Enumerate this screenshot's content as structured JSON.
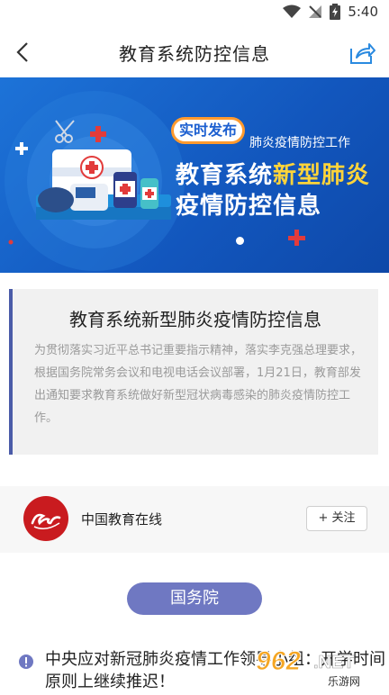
{
  "status_bar": {
    "time": "5:40"
  },
  "header": {
    "title": "教育系统防控信息"
  },
  "banner": {
    "tag": "实时发布",
    "subtitle": "肺炎疫情防控工作",
    "headline_part1": "教育系统",
    "headline_accent": "新型肺炎",
    "headline_line2": "疫情防控信息"
  },
  "intro": {
    "title": "教育系统新型肺炎疫情防控信息",
    "body": "为贯彻落实习近平总书记重要指示精神，落实李克强总理要求，根据国务院常务会议和电视电话会议部署，1月21日，教育部发出通知要求教育系统做好新型冠状病毒感染的肺炎疫情防控工作。"
  },
  "source": {
    "name": "中国教育在线",
    "follow_label": "+ 关注"
  },
  "section": {
    "label": "国务院"
  },
  "news": [
    {
      "text": "中央应对新冠肺炎疫情工作领导小组：开学时间原则上继续推迟！"
    }
  ],
  "watermark": {
    "main": "962",
    "suffix": ".NET",
    "sub": "乐游网"
  },
  "colors": {
    "banner_blue": "#1565c8",
    "accent_yellow": "#ffd43a",
    "section_purple": "#6f78c2",
    "card_border": "#4a5ba8",
    "avatar_red": "#c91b1f"
  }
}
